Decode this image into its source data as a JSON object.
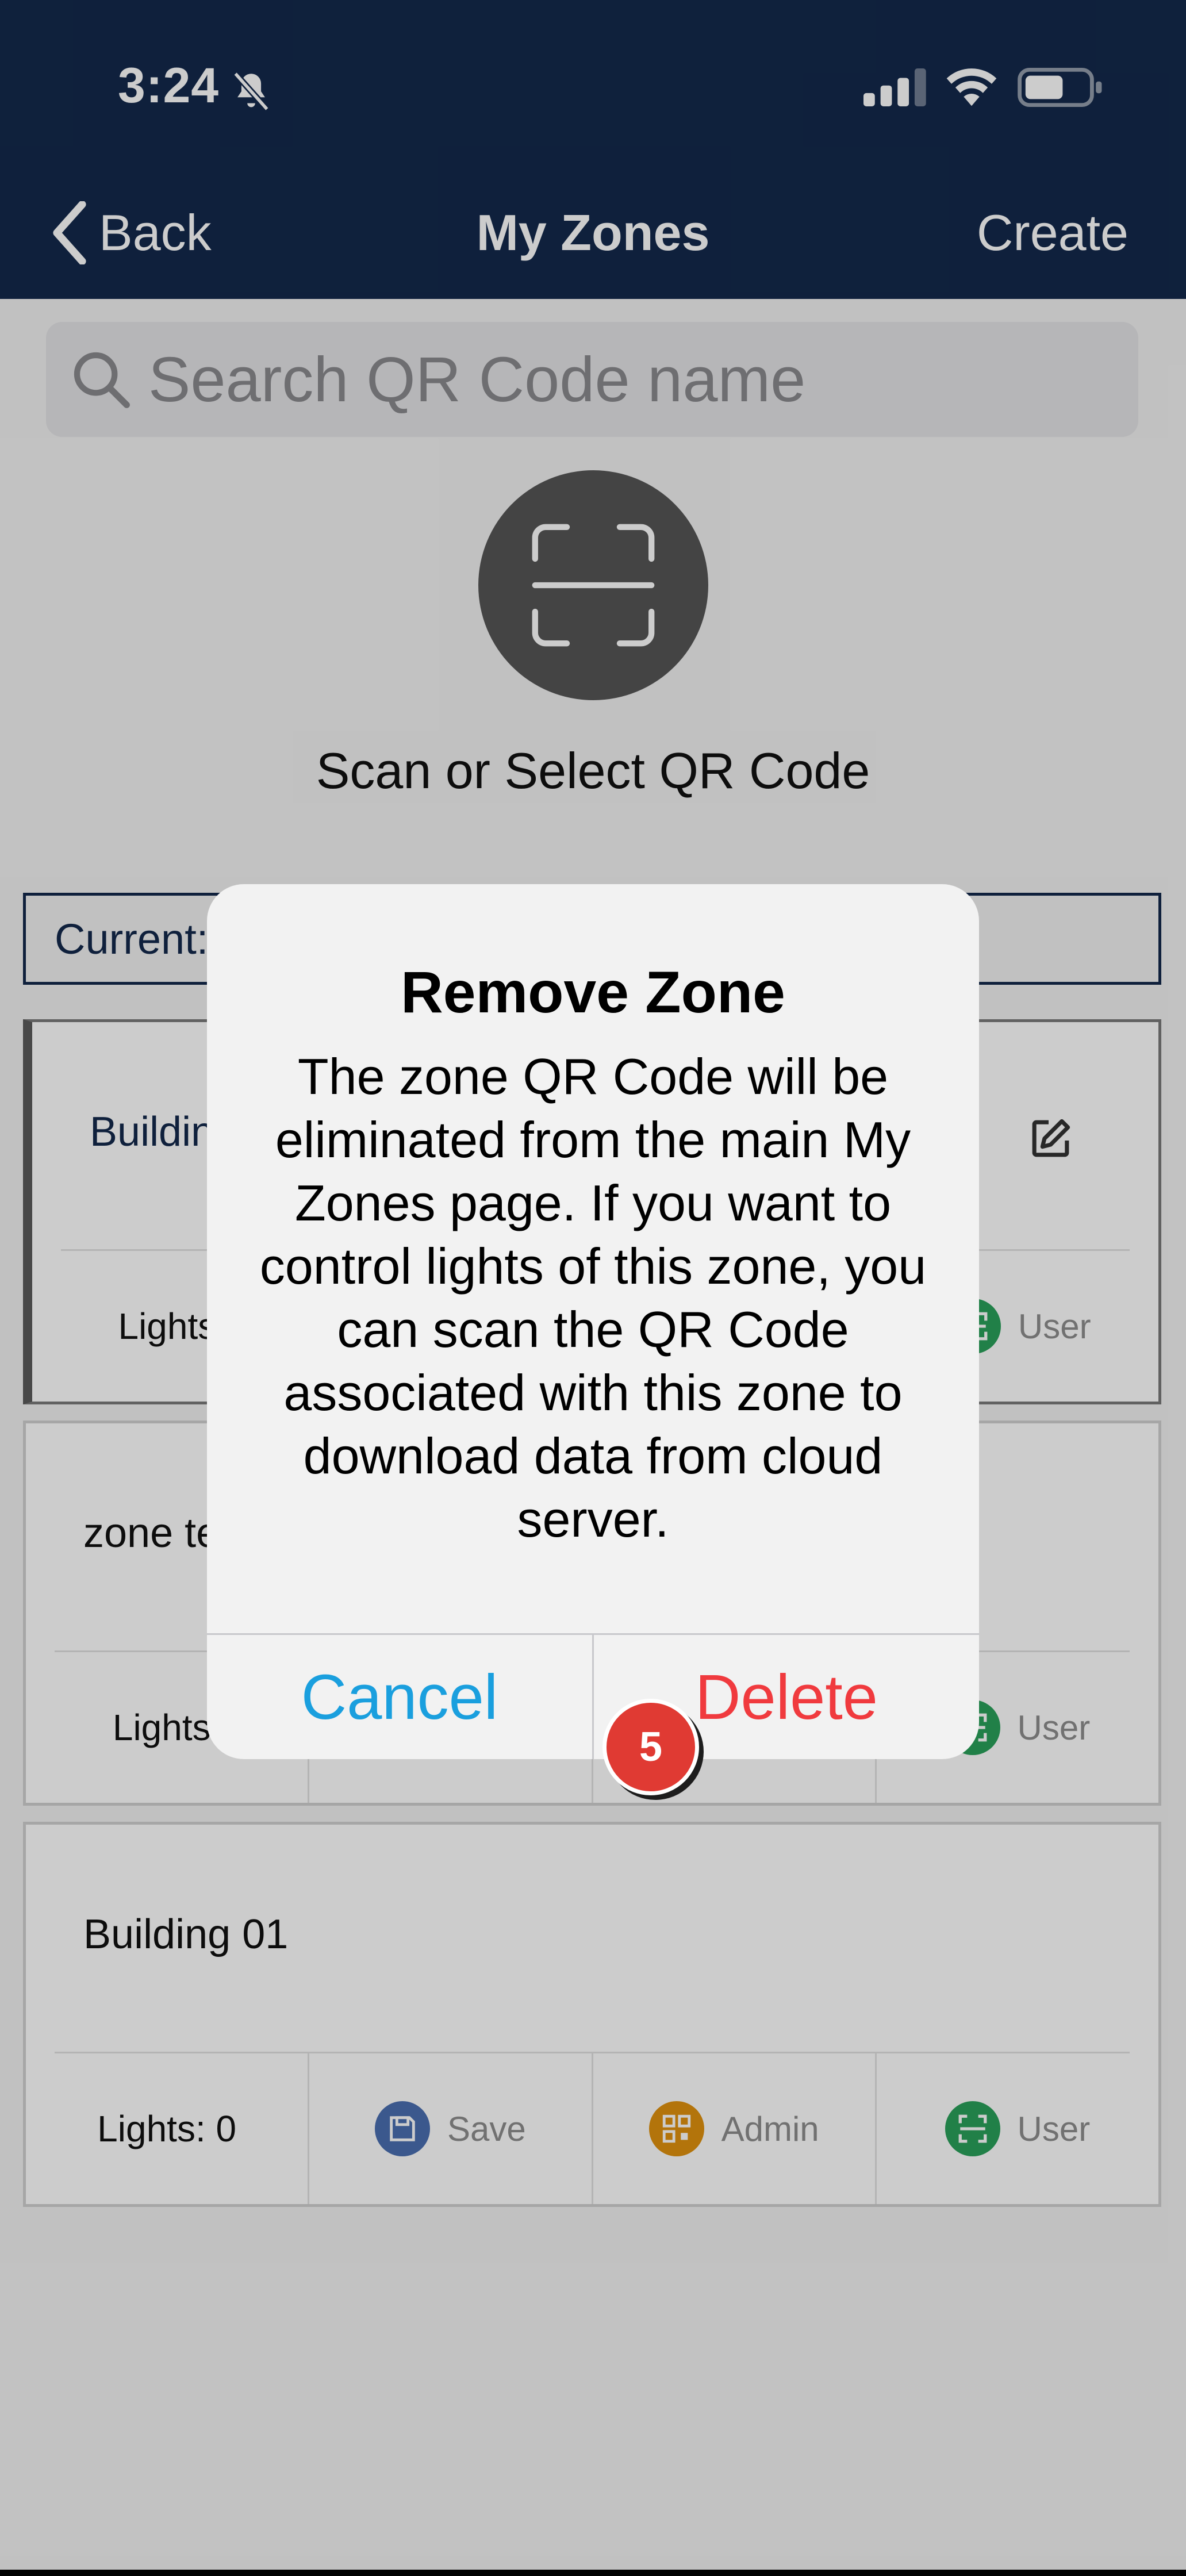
{
  "status_bar": {
    "time": "3:24",
    "icons": [
      "bell-slash-icon",
      "cellular-signal-icon",
      "wifi-icon",
      "battery-icon"
    ]
  },
  "nav": {
    "back_label": "Back",
    "title": "My Zones",
    "create_label": "Create"
  },
  "search": {
    "placeholder": "Search QR Code name"
  },
  "scan": {
    "label": "Scan or Select QR Code"
  },
  "current": {
    "label": "Current:"
  },
  "zones": [
    {
      "name": "Building",
      "lights": "Lights:",
      "save": "",
      "admin": "",
      "user": "User",
      "selected": true
    },
    {
      "name": "zone te",
      "lights": "Lights:",
      "save": "",
      "admin": "",
      "user": "User",
      "selected": false
    },
    {
      "name": "Building 01",
      "lights": "Lights: 0",
      "save": "Save",
      "admin": "Admin",
      "user": "User",
      "selected": false
    }
  ],
  "alert": {
    "title": "Remove Zone",
    "message": "The zone QR Code will be eliminated from the main My Zones page. If you want to control lights of this zone, you can scan the QR Code associated with this zone to download data from cloud server.",
    "cancel_label": "Cancel",
    "delete_label": "Delete"
  },
  "step_badge": "5",
  "colors": {
    "header_bg": "#13294b",
    "save_icon": "#4a6fb1",
    "admin_icon": "#e0920e",
    "user_icon": "#2aa05a",
    "cancel": "#1a9fde",
    "delete": "#f03a3e",
    "badge": "#e03a33"
  }
}
